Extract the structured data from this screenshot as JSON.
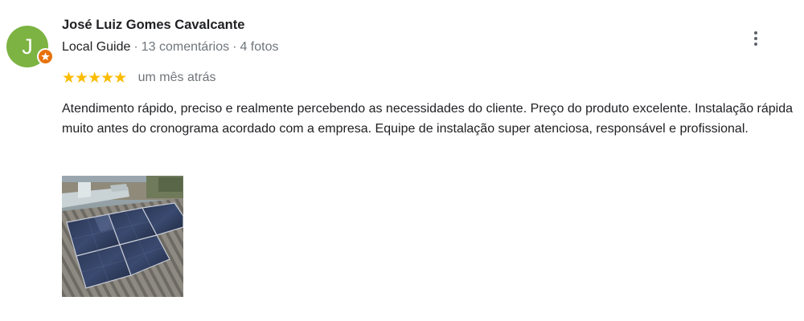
{
  "review": {
    "author": {
      "initial": "J",
      "name": "José Luiz Gomes Cavalcante",
      "role": "Local Guide",
      "separator": "·",
      "review_count": "13 comentários",
      "photo_count": "4 fotos",
      "avatar_color": "#7cb342",
      "badge_color": "#e8710a"
    },
    "rating": {
      "stars_text": "★★★★★",
      "value": 5,
      "max": 5,
      "color": "#fbbc04"
    },
    "date": "um mês atrás",
    "text": "Atendimento rápido, preciso e realmente percebendo as necessidades do cliente. Preço do produto excelente. Instalação rápida muito antes do cronograma acordado com a empresa. Equipe de instalação super atenciosa, responsável e profissional.",
    "photo": {
      "subject": "solar panels on roof"
    },
    "menu_icon": "more-vertical-icon"
  }
}
